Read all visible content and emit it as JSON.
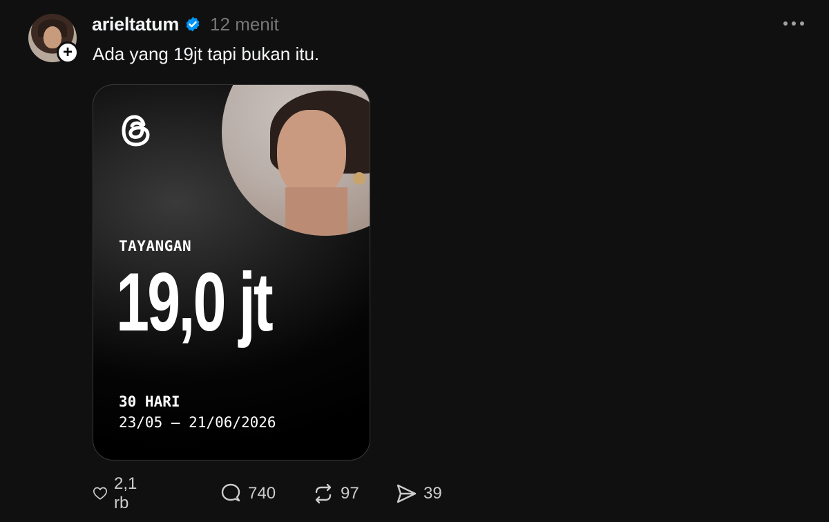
{
  "post": {
    "username": "arieltatum",
    "verified": true,
    "time": "12 menit",
    "caption": "Ada yang 19jt tapi bukan itu.",
    "follow_symbol": "+"
  },
  "card": {
    "logo": "threads-logo-icon",
    "views_label": "TAYANGAN",
    "views_value": "19,0 jt",
    "period_label": "30 HARI",
    "date_range": "23/05 – 21/06/2026"
  },
  "actions": {
    "likes": "2,1 rb",
    "comments": "740",
    "reposts": "97",
    "shares": "39"
  },
  "colors": {
    "background": "#101010",
    "text": "#f3f5f7",
    "muted": "#777777",
    "verified_blue": "#0095f6"
  }
}
